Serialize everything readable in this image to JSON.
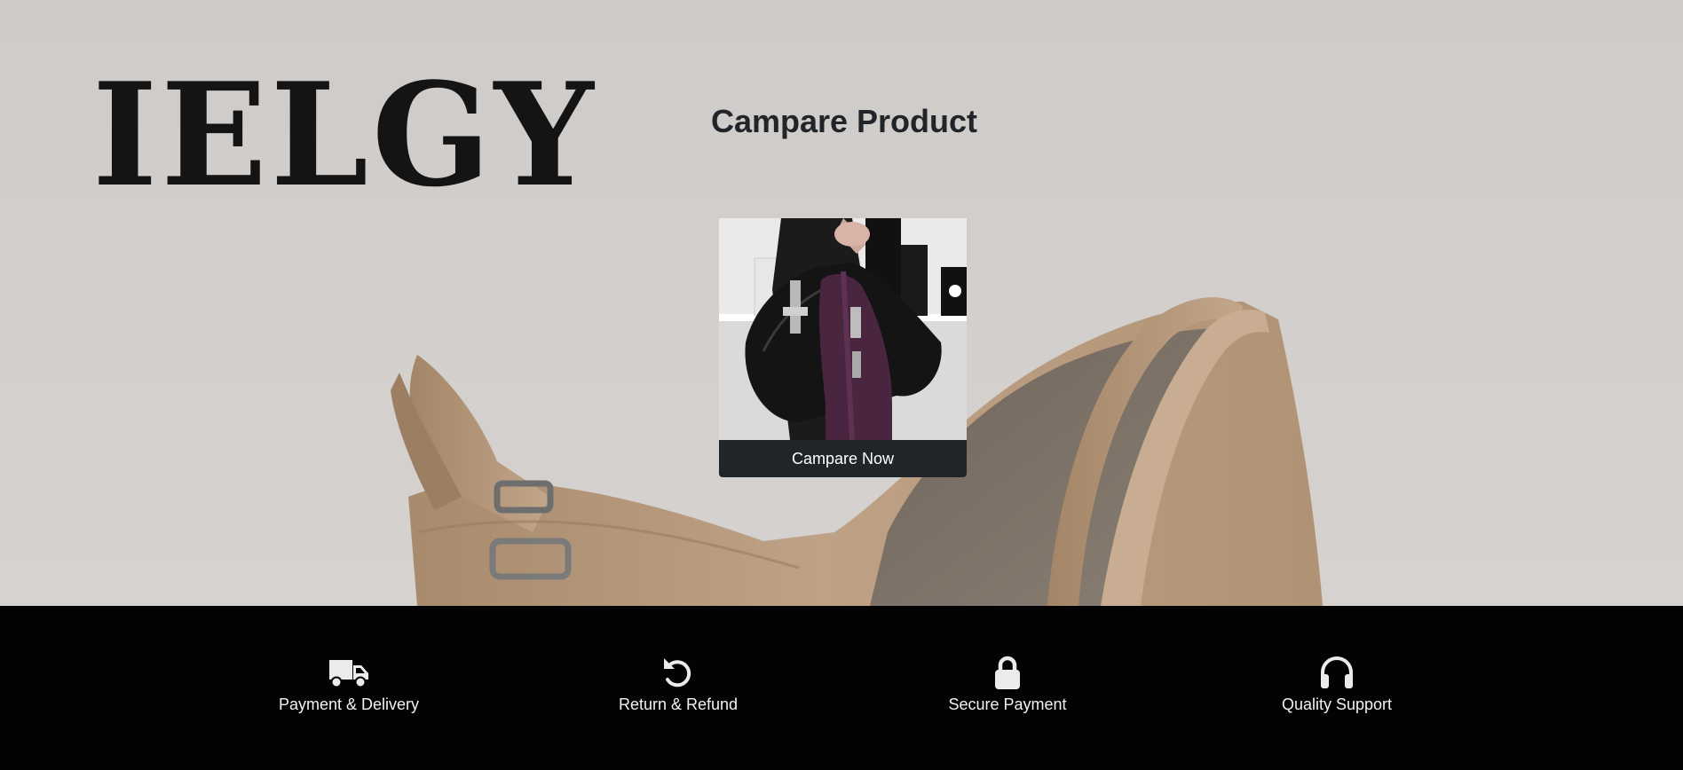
{
  "brand": {
    "logo_text": "IELGY"
  },
  "compare_section": {
    "title": "Campare Product",
    "product_image_alt": "handbags",
    "button_label": "Campare Now"
  },
  "features": [
    {
      "label": "Payment & Delivery",
      "icon": "truck-icon"
    },
    {
      "label": "Return & Refund",
      "icon": "rotate-left-icon"
    },
    {
      "label": "Secure Payment",
      "icon": "lock-icon"
    },
    {
      "label": "Quality Support",
      "icon": "headphones-icon"
    }
  ],
  "colors": {
    "hero_background": "#d2cecb",
    "title_text": "#212529",
    "button_bg": "#212529",
    "button_text": "#ffffff",
    "footer_bg": "#030303",
    "footer_text": "#f2f2f2",
    "bag_tan": "#b79a7d"
  }
}
